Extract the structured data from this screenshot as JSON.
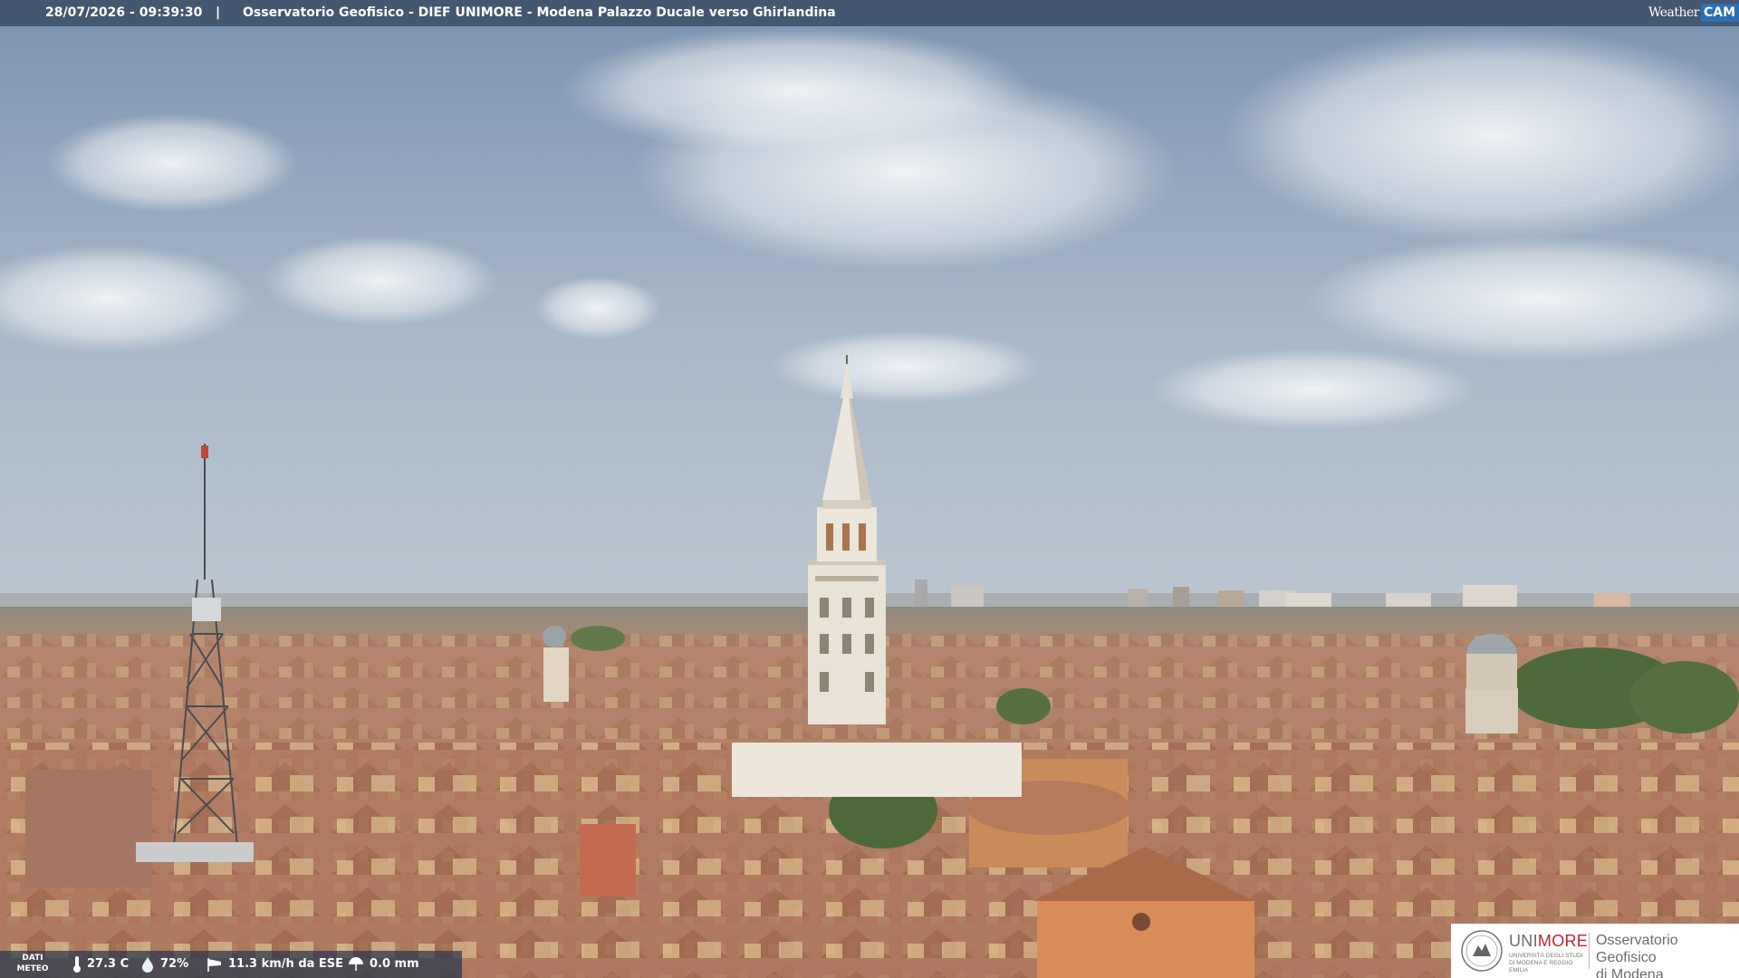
{
  "header": {
    "timestamp": "28/07/2026 - 09:39:30",
    "separator": "|",
    "caption": "Osservatorio Geofisico - DIEF UNIMORE - Modena Palazzo Ducale verso Ghirlandina",
    "brand_weather": "Weather",
    "brand_cam": "CAM"
  },
  "meteo": {
    "label_line1": "DATI",
    "label_line2": "METEO",
    "temperature": "27.3 C",
    "humidity": "72%",
    "wind": "11.3 km/h da ESE",
    "rain": "0.0 mm"
  },
  "logo": {
    "uni_part1": "UNI",
    "uni_part2": "MORE",
    "uni_subtitle": "UNIVERSITÀ DEGLI STUDI DI MODENA E REGGIO EMILIA",
    "observatory_line1": "Osservatorio Geofisico",
    "observatory_line2": "di Modena"
  },
  "icons": {
    "temperature": "thermometer-icon",
    "humidity": "droplet-icon",
    "wind": "windsock-icon",
    "rain": "umbrella-icon"
  },
  "colors": {
    "sky_top": "#7f97b3",
    "sky_horizon": "#b9c5d2",
    "roof": "#b9876a",
    "tower": "#e7e1d6",
    "unimore_red": "#c1272d",
    "cam_blue": "#2d6fb3"
  }
}
